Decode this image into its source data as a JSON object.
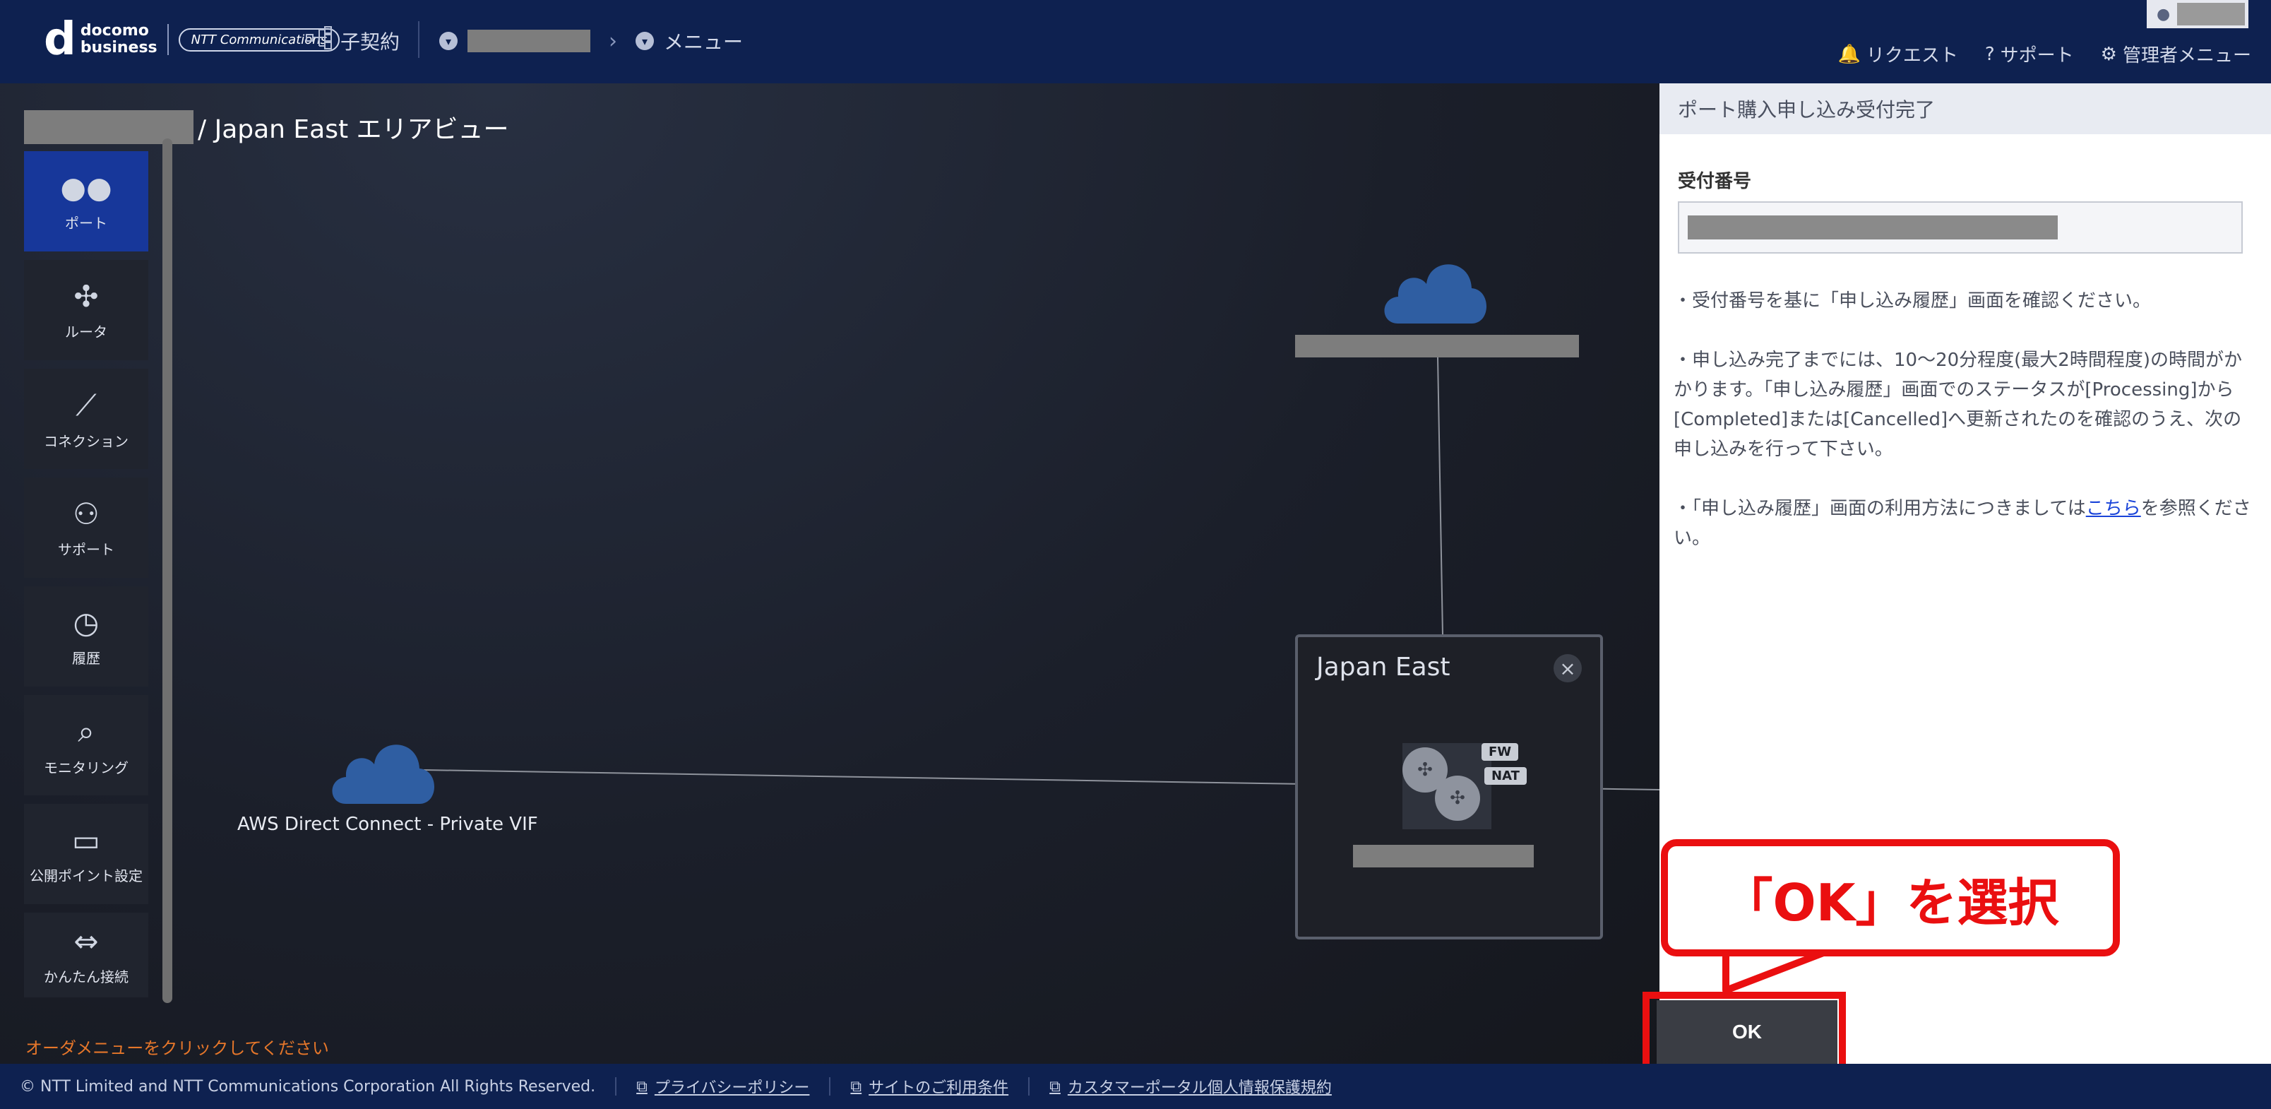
{
  "header": {
    "logo_mark": "d",
    "logo_line1": "docomo",
    "logo_line2": "business",
    "logo_ntt": "NTT Communications",
    "sub_contract": "子契約",
    "menu_label": "メニュー",
    "links": [
      "リクエスト",
      "サポート",
      "管理者メニュー"
    ]
  },
  "canvas": {
    "title_suffix": "/ Japan East エリアビュー",
    "sidebar": [
      {
        "label": "ポート",
        "icon": "port-icon",
        "active": true
      },
      {
        "label": "ルータ",
        "icon": "router-icon",
        "active": false
      },
      {
        "label": "コネクション",
        "icon": "connection-icon",
        "active": false
      },
      {
        "label": "サポート",
        "icon": "support-icon",
        "active": false
      },
      {
        "label": "履歴",
        "icon": "history-icon",
        "active": false
      },
      {
        "label": "モニタリング",
        "icon": "monitoring-icon",
        "active": false
      },
      {
        "label": "公開ポイント設定",
        "icon": "public-point-icon",
        "active": false
      },
      {
        "label": "かんたん接続",
        "icon": "easy-connect-icon",
        "active": false
      }
    ],
    "hint": "オーダメニューをクリックしてください",
    "aws_label": "AWS Direct Connect - Private VIF",
    "region_name": "Japan East",
    "tags": [
      "FW",
      "NAT"
    ]
  },
  "panel": {
    "title": "ポート購入申し込み受付完了",
    "field_label": "受付番号",
    "note1": "・受付番号を基に「申し込み履歴」画面を確認ください。",
    "note2": "・申し込み完了までには、10～20分程度(最大2時間程度)の時間がかかります。「申し込み履歴」画面でのステータスが[Processing]から[Completed]または[Cancelled]へ更新されたのを確認のうえ、次の申し込みを行って下さい。",
    "note3_pre": "・「申し込み履歴」画面の利用方法につきましては",
    "note3_link": "こちら",
    "note3_post": "を参照ください。",
    "ok_label": "OK"
  },
  "annotation": {
    "callout_text": "「OK」を選択",
    "color": "#ea0f10"
  },
  "footer": {
    "copyright": "© NTT Limited and NTT Communications Corporation All Rights Reserved.",
    "links": [
      "プライバシーポリシー",
      "サイトのご利用条件",
      "カスタマーポータル個人情報保護規約"
    ]
  }
}
